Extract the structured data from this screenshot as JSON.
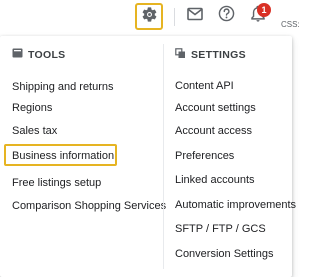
{
  "topbar": {
    "settings_icon": "gear-icon",
    "mail_icon": "mail-icon",
    "help_icon": "help-icon",
    "notifications_icon": "bell-icon",
    "notification_count": "1",
    "corner_text": "CSS:",
    "highlight_color": "#e6b422",
    "badge_color": "#d93025"
  },
  "tools": {
    "heading": "TOOLS",
    "icon": "tools-icon",
    "items": [
      {
        "label": "Shipping and returns"
      },
      {
        "label": "Regions"
      },
      {
        "label": "Sales tax"
      },
      {
        "label": "Business information"
      },
      {
        "label": "Free listings setup"
      },
      {
        "label": "Comparison Shopping Services"
      }
    ]
  },
  "settings": {
    "heading": "SETTINGS",
    "icon": "settings-icon",
    "items": [
      {
        "label": "Content API"
      },
      {
        "label": "Account settings"
      },
      {
        "label": "Account access"
      },
      {
        "label": "Preferences"
      },
      {
        "label": "Linked accounts"
      },
      {
        "label": "Automatic improvements"
      },
      {
        "label": "SFTP / FTP / GCS"
      },
      {
        "label": "Conversion Settings"
      }
    ]
  }
}
